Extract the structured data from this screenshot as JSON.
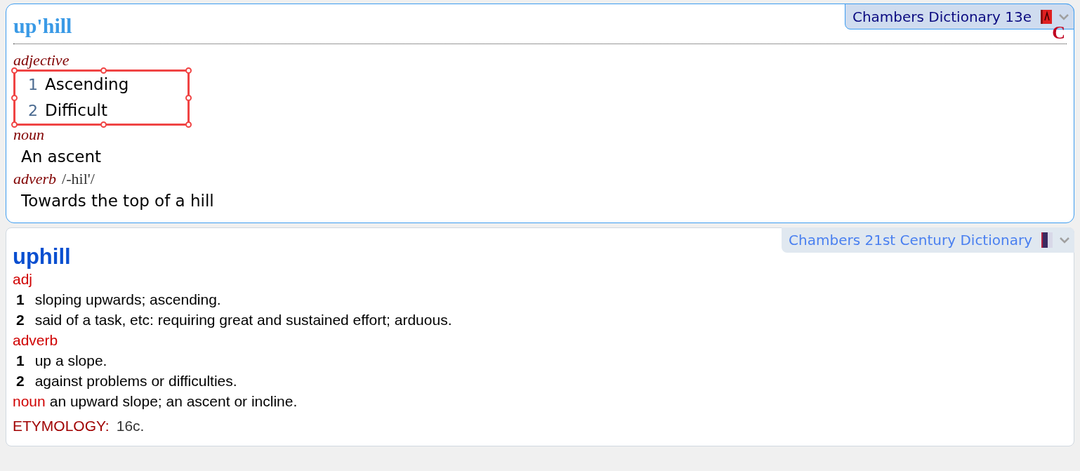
{
  "entries": [
    {
      "dictionary": "Chambers Dictionary 13e",
      "kind": "classic",
      "active": true,
      "icon_mark": "C",
      "headword": "up'hill",
      "sections": [
        {
          "pos": "adjective",
          "selected": true,
          "senses": [
            {
              "num": "1",
              "text": "Ascending"
            },
            {
              "num": "2",
              "text": "Difficult"
            }
          ]
        },
        {
          "pos": "noun",
          "selected": false,
          "senses": [
            {
              "text": "An ascent"
            }
          ]
        },
        {
          "pos": "adverb",
          "pron": "/-hil'/",
          "selected": false,
          "senses": [
            {
              "text": "Towards the top of a hill"
            }
          ]
        }
      ]
    },
    {
      "dictionary": "Chambers 21st Century Dictionary",
      "kind": "modern",
      "active": false,
      "headword": "uphill",
      "sections": [
        {
          "pos": "adj",
          "senses": [
            {
              "num": "1",
              "text": "sloping upwards; ascending."
            },
            {
              "num": "2",
              "text": "said of a task, etc: requiring great and sustained effort; arduous."
            }
          ]
        },
        {
          "pos": "adverb",
          "senses": [
            {
              "num": "1",
              "text": "up a slope."
            },
            {
              "num": "2",
              "text": "against problems or difficulties."
            }
          ]
        },
        {
          "pos": "noun",
          "inline": "an upward slope; an ascent or incline."
        }
      ],
      "etymology": {
        "label": "ETYMOLOGY:",
        "text": "16c."
      }
    }
  ]
}
